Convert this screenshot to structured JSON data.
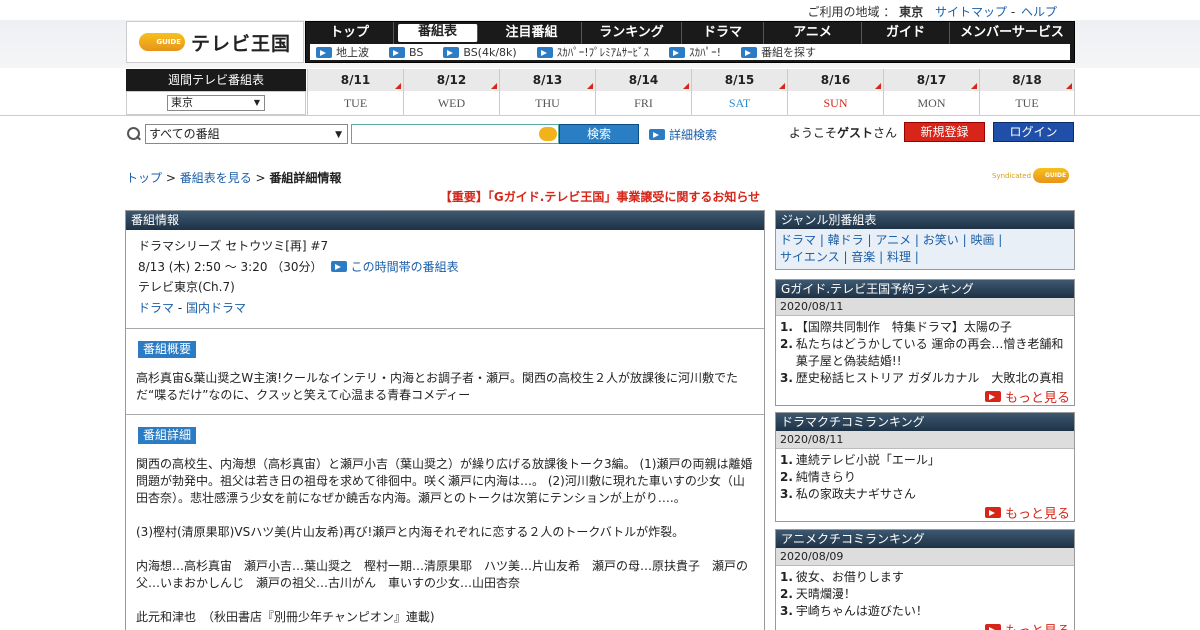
{
  "util": {
    "area_label": "ご利用の地域 ：",
    "area_value": "東京",
    "sitemap": "サイトマップ",
    "sep": "-",
    "help": "ヘルプ"
  },
  "logo": {
    "g": "GUIDE",
    "text": "テレビ王国"
  },
  "nav": {
    "items": [
      "トップ",
      "番組表",
      "注目番組",
      "ランキング",
      "ドラマ",
      "アニメ",
      "ガイド",
      "メンバーサービス"
    ],
    "sub": [
      "地上波",
      "BS",
      "BS(4k/8k)",
      "ｽｶﾊﾟｰ!ﾌﾟﾚﾐｱﾑｻｰﾋﾞｽ",
      "ｽｶﾊﾟｰ!",
      "番組を探す"
    ]
  },
  "week": {
    "header": "週間テレビ番組表",
    "area": "東京",
    "days": [
      {
        "d": "8/11",
        "w": "TUE"
      },
      {
        "d": "8/12",
        "w": "WED"
      },
      {
        "d": "8/13",
        "w": "THU"
      },
      {
        "d": "8/14",
        "w": "FRI"
      },
      {
        "d": "8/15",
        "w": "SAT"
      },
      {
        "d": "8/16",
        "w": "SUN"
      },
      {
        "d": "8/17",
        "w": "MON"
      },
      {
        "d": "8/18",
        "w": "TUE"
      }
    ]
  },
  "search": {
    "select": "すべての番組",
    "button": "検索",
    "advanced": "詳細検索"
  },
  "user": {
    "welcome_pre": "ようこそ",
    "guest": "ゲスト",
    "welcome_post": "さん",
    "register": "新規登録",
    "login": "ログイン"
  },
  "breadcrumb": {
    "top": "トップ",
    "sep": " > ",
    "list": "番組表を見る",
    "current": "番組詳細情報"
  },
  "synd": {
    "s": "Syndicated",
    "g": "GUIDE"
  },
  "notice": "【重要】「Gガイド.テレビ王国」事業譲受に関するお知らせ",
  "program": {
    "header": "番組情報",
    "title": "ドラマシリーズ セトウツミ[再] #7",
    "time": "8/13 (木) 2:50 ～ 3:20 （30分）",
    "time_link": "この時間帯の番組表",
    "channel": "テレビ東京(Ch.7)",
    "genre1": "ドラマ",
    "genre_sep": " - ",
    "genre2": "国内ドラマ",
    "summary_tag": "番組概要",
    "summary": "高杉真宙&葉山奨之W主演!クールなインテリ・内海とお調子者・瀬戸。関西の高校生２人が放課後に河川敷でただ“喋るだけ”なのに、クスッと笑えて心温まる青春コメディー",
    "detail_tag": "番組詳細",
    "details": [
      "関西の高校生、内海想（高杉真宙）と瀬戸小吉（葉山奨之）が繰り広げる放課後トーク3編。 (1)瀬戸の両親は離婚問題が勃発中。祖父は若き日の祖母を求めて徘徊中。咲く瀬戸に内海は…。 (2)河川敷に現れた車いすの少女（山田杏奈）。悲壮感漂う少女を前になぜか饒舌な内海。瀬戸とのトークは次第にテンションが上がり….。",
      "(3)樫村(清原果耶)VSハツ美(片山友希)再び!瀬戸と内海それぞれに恋する２人のトークバトルが炸裂。",
      "内海想…高杉真宙　瀬戸小吉…葉山奨之　樫村一期…清原果耶　ハツ美…片山友希　瀬戸の母…原扶貴子　瀬戸の父…いまおかしんじ　瀬戸の祖父…古川がん　車いすの少女…山田杏奈",
      "此元和津也　（秋田書店『別冊少年チャンピオン』連載)"
    ]
  },
  "side": {
    "genre_header": "ジャンル別番組表",
    "genres_line1": "ドラマ | 韓ドラ | アニメ | お笑い | 映画 |",
    "genres_line2": "サイエンス | 音楽 | 料理 |",
    "rank1": {
      "header": "Gガイド.テレビ王国予約ランキング",
      "date": "2020/08/11",
      "items": [
        "【国際共同制作　特集ドラマ】太陽の子",
        "私たちはどうかしている 運命の再会…憎き老舗和菓子屋と偽装結婚!!",
        "歴史秘話ヒストリア ガダルカナル　大敗北の真相"
      ],
      "more": "もっと見る"
    },
    "rank2": {
      "header": "ドラマクチコミランキング",
      "date": "2020/08/11",
      "items": [
        "連続テレビ小説「エール」",
        "純情きらり",
        "私の家政夫ナギサさん"
      ],
      "more": "もっと見る"
    },
    "rank3": {
      "header": "アニメクチコミランキング",
      "date": "2020/08/09",
      "items": [
        "彼女、お借りします",
        "天晴爛漫！",
        "宇崎ちゃんは遊びたい！"
      ],
      "more": "もっと見る"
    }
  }
}
